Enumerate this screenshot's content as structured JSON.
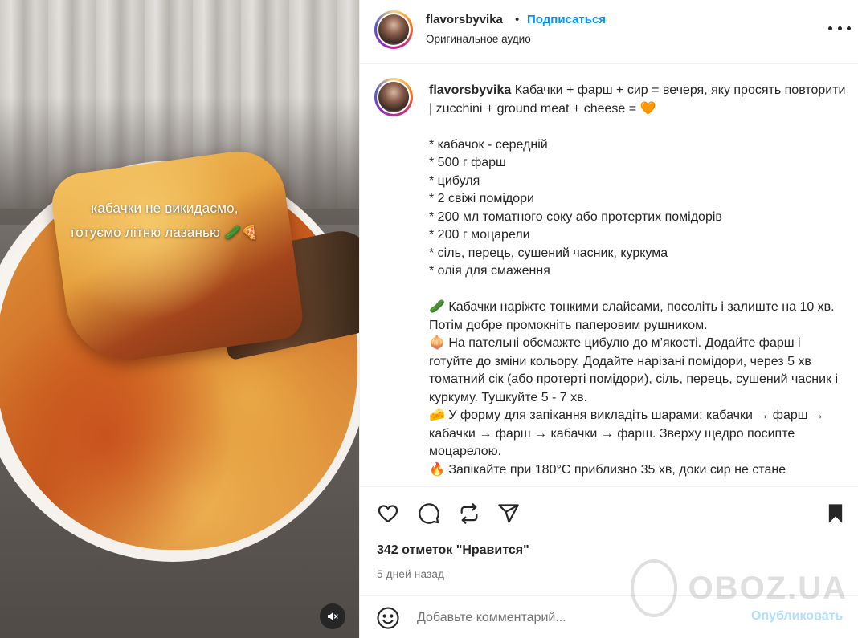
{
  "media": {
    "overlay_line1": "кабачки не викидаємо,",
    "overlay_line2": "готуємо літню лазанью 🥒🍕"
  },
  "header": {
    "username": "flavorsbyvika",
    "separator": "•",
    "follow_label": "Подписаться",
    "audio_label": "Оригинальное аудио"
  },
  "caption": {
    "username": "flavorsbyvika",
    "title": "Кабачки + фарш + сир = вечеря, яку просять повторити | zucchini + ground meat + cheese = 🧡",
    "ingredients": [
      "* кабачок - середній",
      "* 500 г фарш",
      "* цибуля",
      "* 2 свіжі помідори",
      "* 200 мл томатного соку або протертих помідорів",
      "* 200 г моцарели",
      "* сіль, перець, сушений часник, куркума",
      "* олія для смаження"
    ],
    "steps": [
      "🥒 Кабачки наріжте тонкими слайсами, посоліть і залиште на 10 хв. Потім добре промокніть паперовим рушником.",
      "🧅 На пательні обсмажте цибулю до м’якості. Додайте фарш і готуйте до зміни кольору. Додайте нарізані помідори, через 5 хв томатний сік (або протерті помідори), сіль, перець, сушений часник і куркуму. Тушкуйте 5 - 7 хв.",
      "🧀 У форму для запікання викладіть шарами: кабачки → фарш → кабачки → фарш → кабачки → фарш. Зверху щедро посипте моцарелою.",
      "🔥 Запікайте при 180°C приблизно 35 хв, доки сир не стане"
    ]
  },
  "actions": {
    "likes": "342 отметок \"Нравится\"",
    "time": "5 дней назад"
  },
  "comment": {
    "placeholder": "Добавьте комментарий...",
    "publish_label": "Опубликовать"
  },
  "watermark": {
    "text": "OBOZ.UA"
  },
  "colors": {
    "accent": "#0095f6",
    "publish_disabled": "#b2dffc",
    "text": "#262626",
    "muted": "#737373"
  },
  "icons": [
    "more-icon",
    "heart-icon",
    "comment-icon",
    "repost-icon",
    "share-icon",
    "bookmark-icon",
    "emoji-icon",
    "mute-icon"
  ]
}
